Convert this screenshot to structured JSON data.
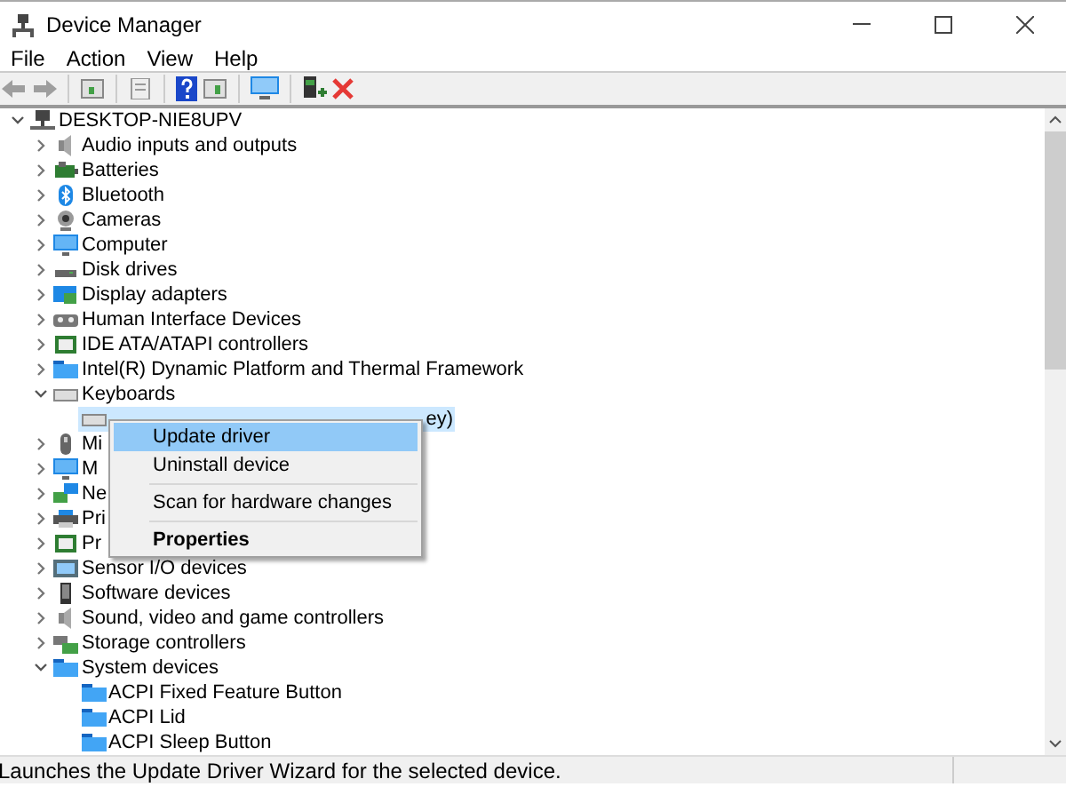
{
  "window": {
    "title": "Device Manager"
  },
  "menu": [
    "File",
    "Action",
    "View",
    "Help"
  ],
  "tree": {
    "label": "DESKTOP-NIE8UPV",
    "expanded": true,
    "children": [
      {
        "label": "Audio inputs and outputs",
        "expanded": false
      },
      {
        "label": "Batteries",
        "expanded": false
      },
      {
        "label": "Bluetooth",
        "expanded": false
      },
      {
        "label": "Cameras",
        "expanded": false
      },
      {
        "label": "Computer",
        "expanded": false
      },
      {
        "label": "Disk drives",
        "expanded": false
      },
      {
        "label": "Display adapters",
        "expanded": false
      },
      {
        "label": "Human Interface Devices",
        "expanded": false
      },
      {
        "label": "IDE ATA/ATAPI controllers",
        "expanded": false
      },
      {
        "label": "Intel(R) Dynamic Platform and Thermal Framework",
        "expanded": false
      },
      {
        "label": "Keyboards",
        "expanded": true,
        "children": [
          {
            "label": "ey)",
            "selected": true
          }
        ]
      },
      {
        "label": "Mi",
        "expanded": false
      },
      {
        "label": "M",
        "expanded": false
      },
      {
        "label": "Ne",
        "expanded": false
      },
      {
        "label": "Pri",
        "expanded": false
      },
      {
        "label": "Pr",
        "expanded": false
      },
      {
        "label": "Sensor I/O devices",
        "expanded": false
      },
      {
        "label": "Software devices",
        "expanded": false
      },
      {
        "label": "Sound, video and game controllers",
        "expanded": false
      },
      {
        "label": "Storage controllers",
        "expanded": false
      },
      {
        "label": "System devices",
        "expanded": true,
        "children": [
          {
            "label": "ACPI Fixed Feature Button",
            "selected": false
          },
          {
            "label": "ACPI Lid",
            "selected": false
          },
          {
            "label": "ACPI Sleep Button",
            "selected": false
          }
        ]
      }
    ]
  },
  "context_menu": {
    "items": [
      {
        "kind": "item",
        "label": "Update driver",
        "selected": true
      },
      {
        "kind": "item",
        "label": "Uninstall device",
        "selected": false
      },
      {
        "kind": "separator"
      },
      {
        "kind": "item",
        "label": "Scan for hardware changes",
        "selected": false
      },
      {
        "kind": "separator"
      },
      {
        "kind": "default",
        "label": "Properties",
        "selected": false
      }
    ]
  },
  "status_bar": "Launches the Update Driver Wizard for the selected device."
}
